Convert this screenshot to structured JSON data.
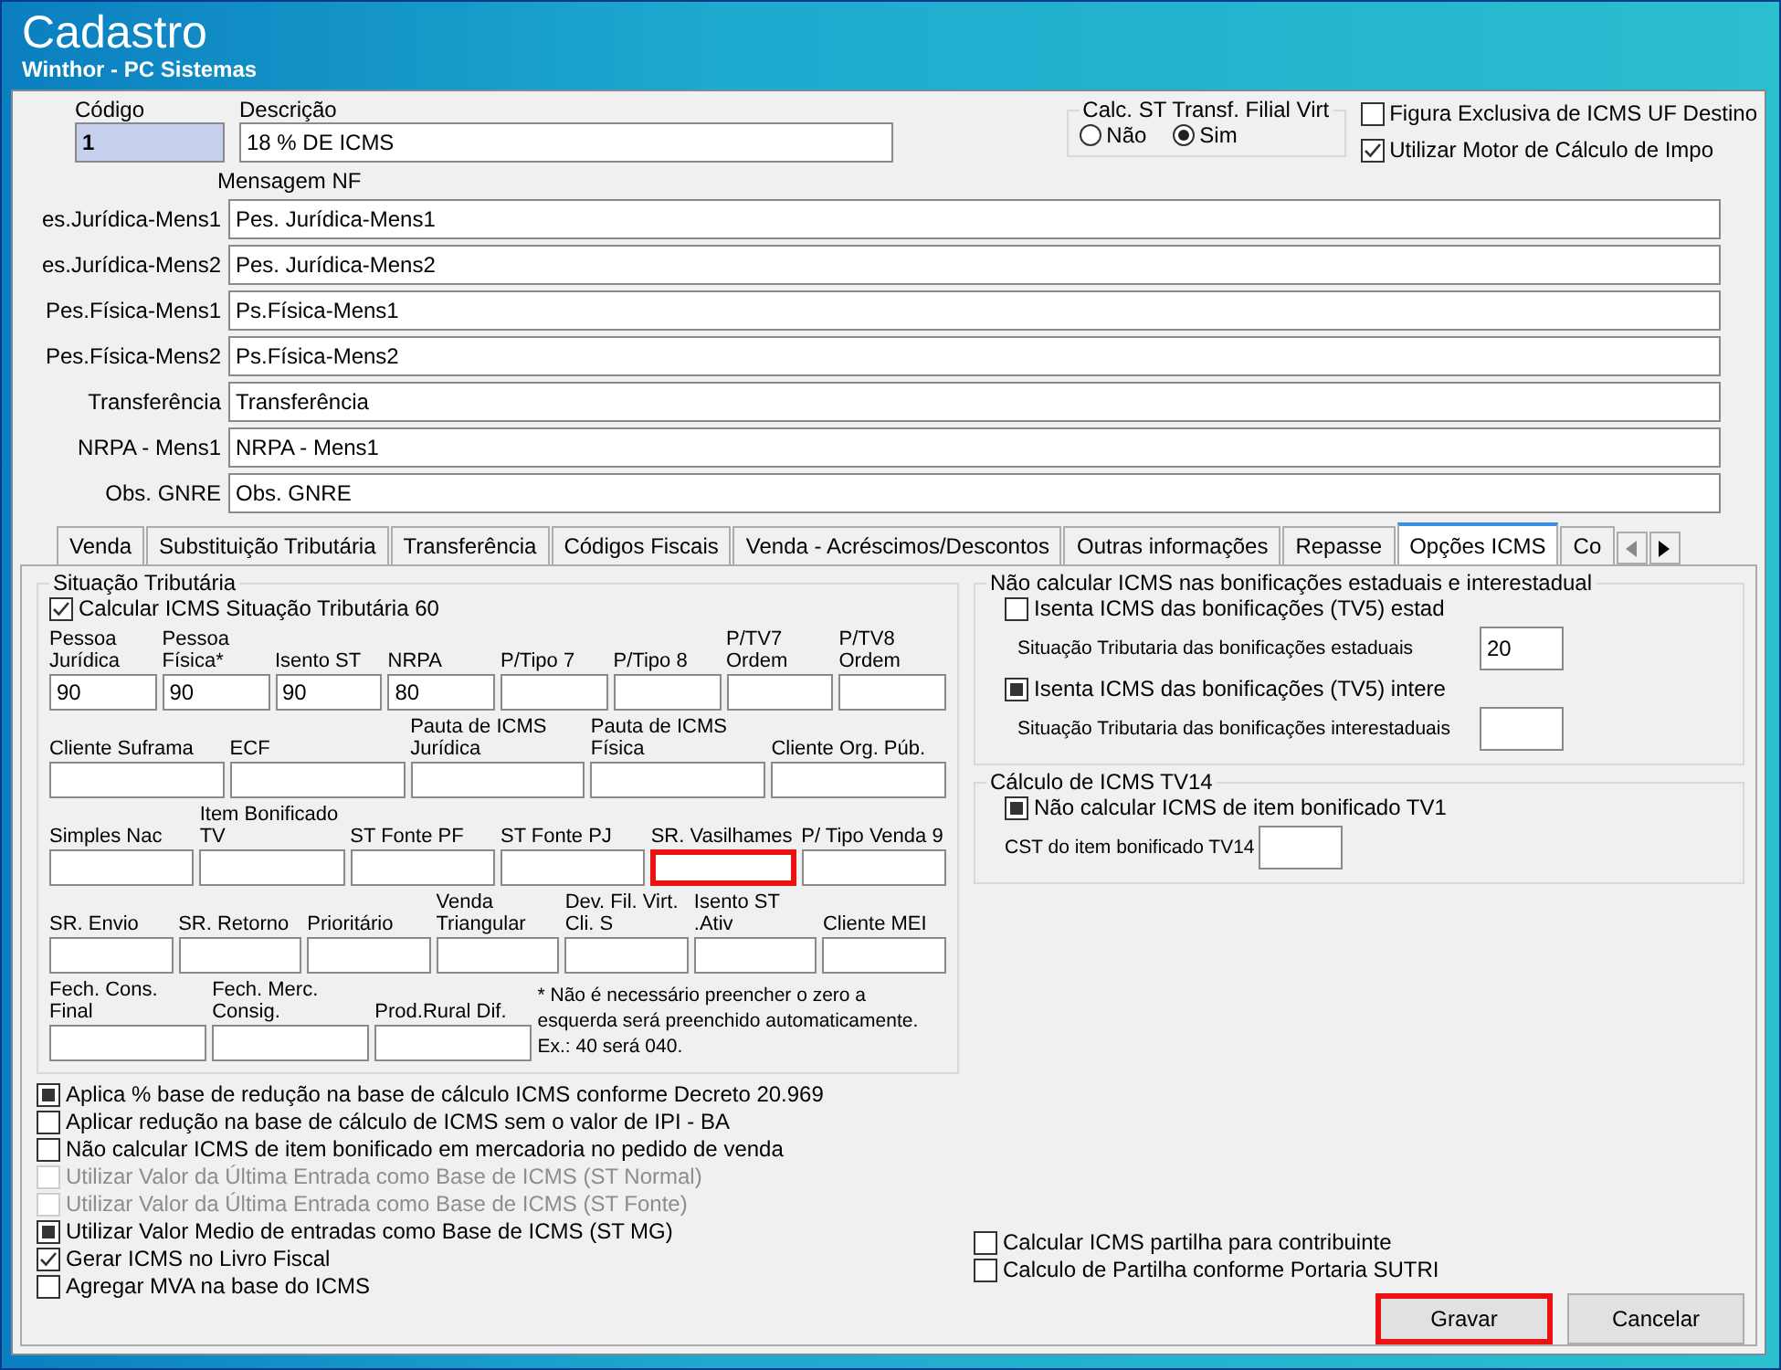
{
  "window": {
    "title": "Cadastro",
    "subtitle": "Winthor - PC Sistemas"
  },
  "header": {
    "codigo": {
      "label": "Código",
      "value": "1"
    },
    "descricao": {
      "label": "Descrição",
      "value": "18 % DE ICMS"
    },
    "calc_st": {
      "title": "Calc. ST Transf. Filial Virt",
      "options": [
        {
          "label": "Não",
          "selected": false
        },
        {
          "label": "Sim",
          "selected": true
        }
      ]
    },
    "checkboxes": [
      {
        "label": "Figura Exclusiva de ICMS UF Destino",
        "checked": false,
        "grayed": false
      },
      {
        "label": "Utilizar Motor de Cálculo de Impo",
        "checked": true,
        "grayed": false
      }
    ]
  },
  "mensagem_nf": {
    "title": "Mensagem NF",
    "rows": [
      {
        "label": "es.Jurídica-Mens1",
        "value": "Pes. Jurídica-Mens1"
      },
      {
        "label": "es.Jurídica-Mens2",
        "value": "Pes. Jurídica-Mens2"
      },
      {
        "label": "Pes.Física-Mens1",
        "value": "Ps.Física-Mens1"
      },
      {
        "label": "Pes.Física-Mens2",
        "value": "Ps.Física-Mens2"
      },
      {
        "label": "Transferência",
        "value": "Transferência"
      },
      {
        "label": "NRPA - Mens1",
        "value": "NRPA - Mens1"
      },
      {
        "label": "Obs. GNRE",
        "value": "Obs. GNRE"
      }
    ]
  },
  "tabs": [
    {
      "label": "Venda",
      "selected": false
    },
    {
      "label": "Substituição Tributária",
      "selected": false
    },
    {
      "label": "Transferência",
      "selected": false
    },
    {
      "label": "Códigos Fiscais",
      "selected": false
    },
    {
      "label": "Venda - Acréscimos/Descontos",
      "selected": false
    },
    {
      "label": "Outras informações",
      "selected": false
    },
    {
      "label": "Repasse",
      "selected": false
    },
    {
      "label": "Opções ICMS",
      "selected": true
    },
    {
      "label": "Co",
      "selected": false
    }
  ],
  "situacao_tributaria": {
    "title": "Situação Tributária",
    "checkbox": {
      "label": "Calcular ICMS Situação Tributária 60",
      "checked": true,
      "grayed": false
    },
    "rows": [
      {
        "fields": [
          {
            "label": "Pessoa Jurídica",
            "value": "90",
            "highlighted": false
          },
          {
            "label": "Pessoa Física*",
            "value": "90",
            "highlighted": false
          },
          {
            "label": "Isento ST",
            "value": "90",
            "highlighted": false
          },
          {
            "label": "NRPA",
            "value": "80",
            "highlighted": false
          },
          {
            "label": "P/Tipo 7",
            "highlighted": false
          },
          {
            "label": "P/Tipo 8",
            "highlighted": false
          },
          {
            "label": "P/TV7 Ordem",
            "highlighted": false
          },
          {
            "label": "P/TV8 Ordem",
            "highlighted": false
          }
        ]
      },
      {
        "fields": [
          {
            "label": "Cliente Suframa",
            "highlighted": false
          },
          {
            "label": "ECF",
            "highlighted": false
          },
          {
            "label": "Pauta de ICMS Jurídica",
            "highlighted": false
          },
          {
            "label": "Pauta de ICMS Física",
            "highlighted": false
          },
          {
            "label": "Cliente Org. Púb.",
            "highlighted": false
          }
        ]
      },
      {
        "fields": [
          {
            "label": "Simples Nac",
            "highlighted": false
          },
          {
            "label": "Item Bonificado TV",
            "highlighted": false
          },
          {
            "label": "ST Fonte PF",
            "highlighted": false
          },
          {
            "label": "ST Fonte PJ",
            "highlighted": false
          },
          {
            "label": "SR. Vasilhames",
            "highlighted": true
          },
          {
            "label": "P/ Tipo Venda 9",
            "highlighted": false
          }
        ]
      },
      {
        "fields": [
          {
            "label": "SR. Envio",
            "highlighted": false
          },
          {
            "label": "SR. Retorno",
            "highlighted": false
          },
          {
            "label": "Prioritário",
            "highlighted": false
          },
          {
            "label": "Venda Triangular",
            "highlighted": false
          },
          {
            "label": "Dev. Fil. Virt. Cli. S",
            "highlighted": false
          },
          {
            "label": "Isento ST .Ativ",
            "highlighted": false
          },
          {
            "label": "Cliente MEI",
            "highlighted": false
          }
        ]
      },
      {
        "fields": [
          {
            "label": "Fech. Cons. Final",
            "highlighted": false
          },
          {
            "label": "Fech. Merc. Consig.",
            "highlighted": false
          },
          {
            "label": "Prod.Rural Dif.",
            "highlighted": false
          }
        ]
      }
    ],
    "note": "* Não é necessário preencher o zero a esquerda será preenchido automaticamente.  Ex.: 40 será 040."
  },
  "options_left": [
    {
      "label": "Aplica % base de redução na base de cálculo ICMS conforme Decreto 20.969",
      "checked": false,
      "grayed": true,
      "disabled": false
    },
    {
      "label": "Aplicar redução na base de cálculo de ICMS sem o valor de IPI - BA",
      "checked": false,
      "grayed": false,
      "disabled": false
    },
    {
      "label": "Não calcular ICMS de item bonificado em mercadoria no pedido de venda",
      "checked": false,
      "grayed": false,
      "disabled": false
    },
    {
      "label": "Utilizar Valor da Última Entrada como Base de ICMS (ST Normal)",
      "checked": false,
      "grayed": false,
      "disabled": true
    },
    {
      "label": "Utilizar Valor da Última Entrada como Base de ICMS (ST Fonte)",
      "checked": false,
      "grayed": false,
      "disabled": true
    },
    {
      "label": "Utilizar Valor Medio de entradas como Base de ICMS (ST MG)",
      "checked": false,
      "grayed": true,
      "disabled": false
    },
    {
      "label": "Gerar ICMS no Livro Fiscal",
      "checked": true,
      "grayed": false,
      "disabled": false
    },
    {
      "label": "Agregar MVA na base do ICMS",
      "checked": false,
      "grayed": false,
      "disabled": false
    }
  ],
  "bonificacoes": {
    "title": "Não calcular ICMS nas bonificações estaduais e interestadual",
    "items": [
      {
        "checkbox": {
          "label": "Isenta ICMS das bonificações (TV5) estad",
          "checked": false,
          "grayed": false
        },
        "field_label": "Situação Tributaria das  bonificações estaduais",
        "value": "20"
      },
      {
        "checkbox": {
          "label": "Isenta ICMS das bonificações (TV5) intere",
          "checked": false,
          "grayed": true
        },
        "field_label": "Situação Tributaria das  bonificações interestaduais"
      }
    ]
  },
  "tv14": {
    "title": "Cálculo de ICMS TV14",
    "checkbox": {
      "label": "Não calcular ICMS de item bonificado TV1",
      "checked": false,
      "grayed": true
    },
    "field_label": "CST do item bonificado TV14"
  },
  "options_right": [
    {
      "label": "Calcular ICMS partilha para contribuinte",
      "checked": false,
      "grayed": false
    },
    {
      "label": "Calculo de Partilha conforme Portaria SUTRI",
      "checked": false,
      "grayed": false
    }
  ],
  "buttons": [
    {
      "label": "Gravar",
      "highlighted": true
    },
    {
      "label": "Cancelar",
      "highlighted": false
    }
  ]
}
